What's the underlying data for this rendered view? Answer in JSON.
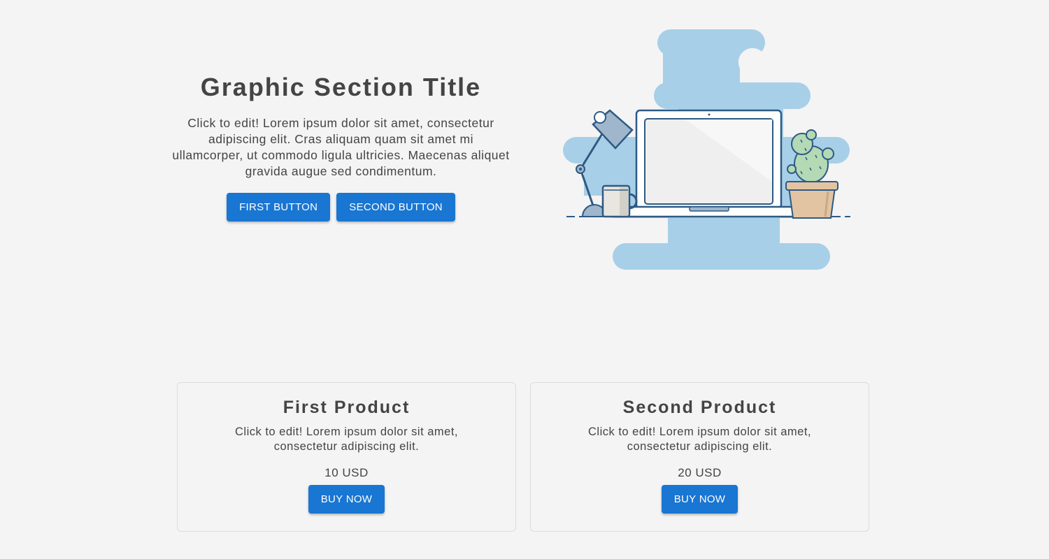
{
  "hero": {
    "title": "Graphic Section Title",
    "text": "Click to edit! Lorem ipsum dolor sit amet, consectetur adipiscing elit. Cras aliquam quam sit amet mi ullamcorper, ut commodo ligula ultricies. Maecenas aliquet gravida augue sed condimentum.",
    "first_button": "FIRST BUTTON",
    "second_button": "SECOND BUTTON"
  },
  "illustration": {
    "description_icon": "workspace-illustration"
  },
  "products": [
    {
      "title": "First Product",
      "text": "Click to edit! Lorem ipsum dolor sit amet, consectetur adipiscing elit.",
      "price": "10 USD",
      "button": "BUY NOW"
    },
    {
      "title": "Second Product",
      "text": "Click to edit! Lorem ipsum dolor sit amet, consectetur adipiscing elit.",
      "price": "20 USD",
      "button": "BUY NOW"
    }
  ],
  "colors": {
    "accent": "#1976d2",
    "background": "#f4f4f4",
    "blob": "#a8cfe8",
    "text": "#444444"
  }
}
